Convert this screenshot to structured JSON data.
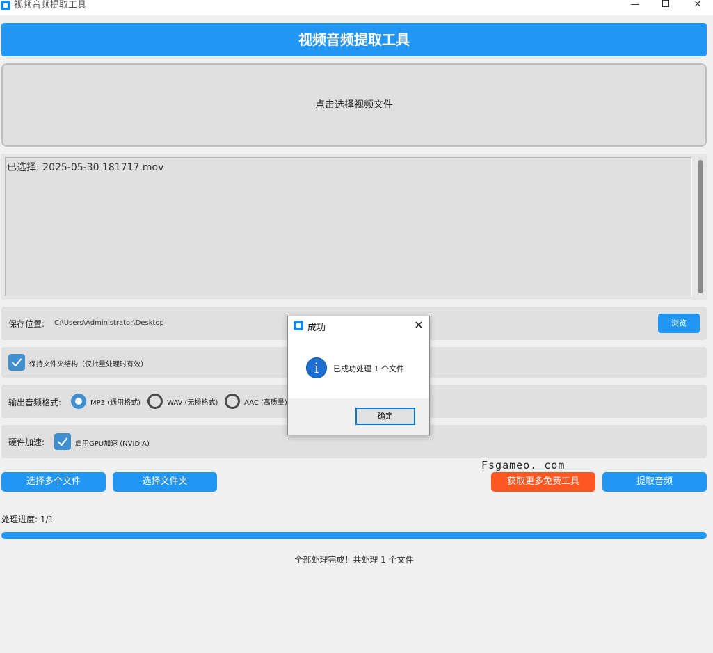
{
  "window": {
    "title": "视频音频提取工具",
    "minimize_glyph": "—",
    "close_glyph": "✕"
  },
  "header": {
    "title": "视频音频提取工具"
  },
  "dropzone": {
    "label": "点击选择视频文件"
  },
  "file_list": {
    "items": [
      "已选择: 2025-05-30 181717.mov"
    ]
  },
  "save_location": {
    "label": "保存位置:",
    "path": "C:\\Users\\Administrator\\Desktop",
    "browse_label": "浏览"
  },
  "keep_structure": {
    "checked": true,
    "label": "保持文件夹结构（仅批量处理时有效）"
  },
  "output_format": {
    "label": "输出音频格式:",
    "options": [
      {
        "label": "MP3 (通用格式)",
        "selected": true
      },
      {
        "label": "WAV (无损格式)",
        "selected": false
      },
      {
        "label": "AAC (高质量)",
        "selected": false
      }
    ]
  },
  "hardware": {
    "label": "硬件加速:",
    "checked": true,
    "gpu_label": "启用GPU加速 (NVIDIA)"
  },
  "watermark": "Fsgameo. com",
  "actions": {
    "select_multiple": "选择多个文件",
    "select_folder": "选择文件夹",
    "more_tools": "获取更多免费工具",
    "extract": "提取音频"
  },
  "progress": {
    "label": "处理进度:  1/1",
    "fraction": 1.0,
    "status": "全部处理完成！共处理 1 个文件"
  },
  "dialog": {
    "title": "成功",
    "close_glyph": "✕",
    "info_glyph": "i",
    "message": "已成功处理 1 个文件",
    "ok_label": "确定"
  },
  "colors": {
    "accent": "#2196f3",
    "orange": "#ff5722",
    "control_blue": "#3e8ed0",
    "panel": "#e0e0e0"
  },
  "icons": [
    "app-icon",
    "minimize-icon",
    "maximize-icon",
    "close-icon",
    "check-icon",
    "info-icon"
  ]
}
